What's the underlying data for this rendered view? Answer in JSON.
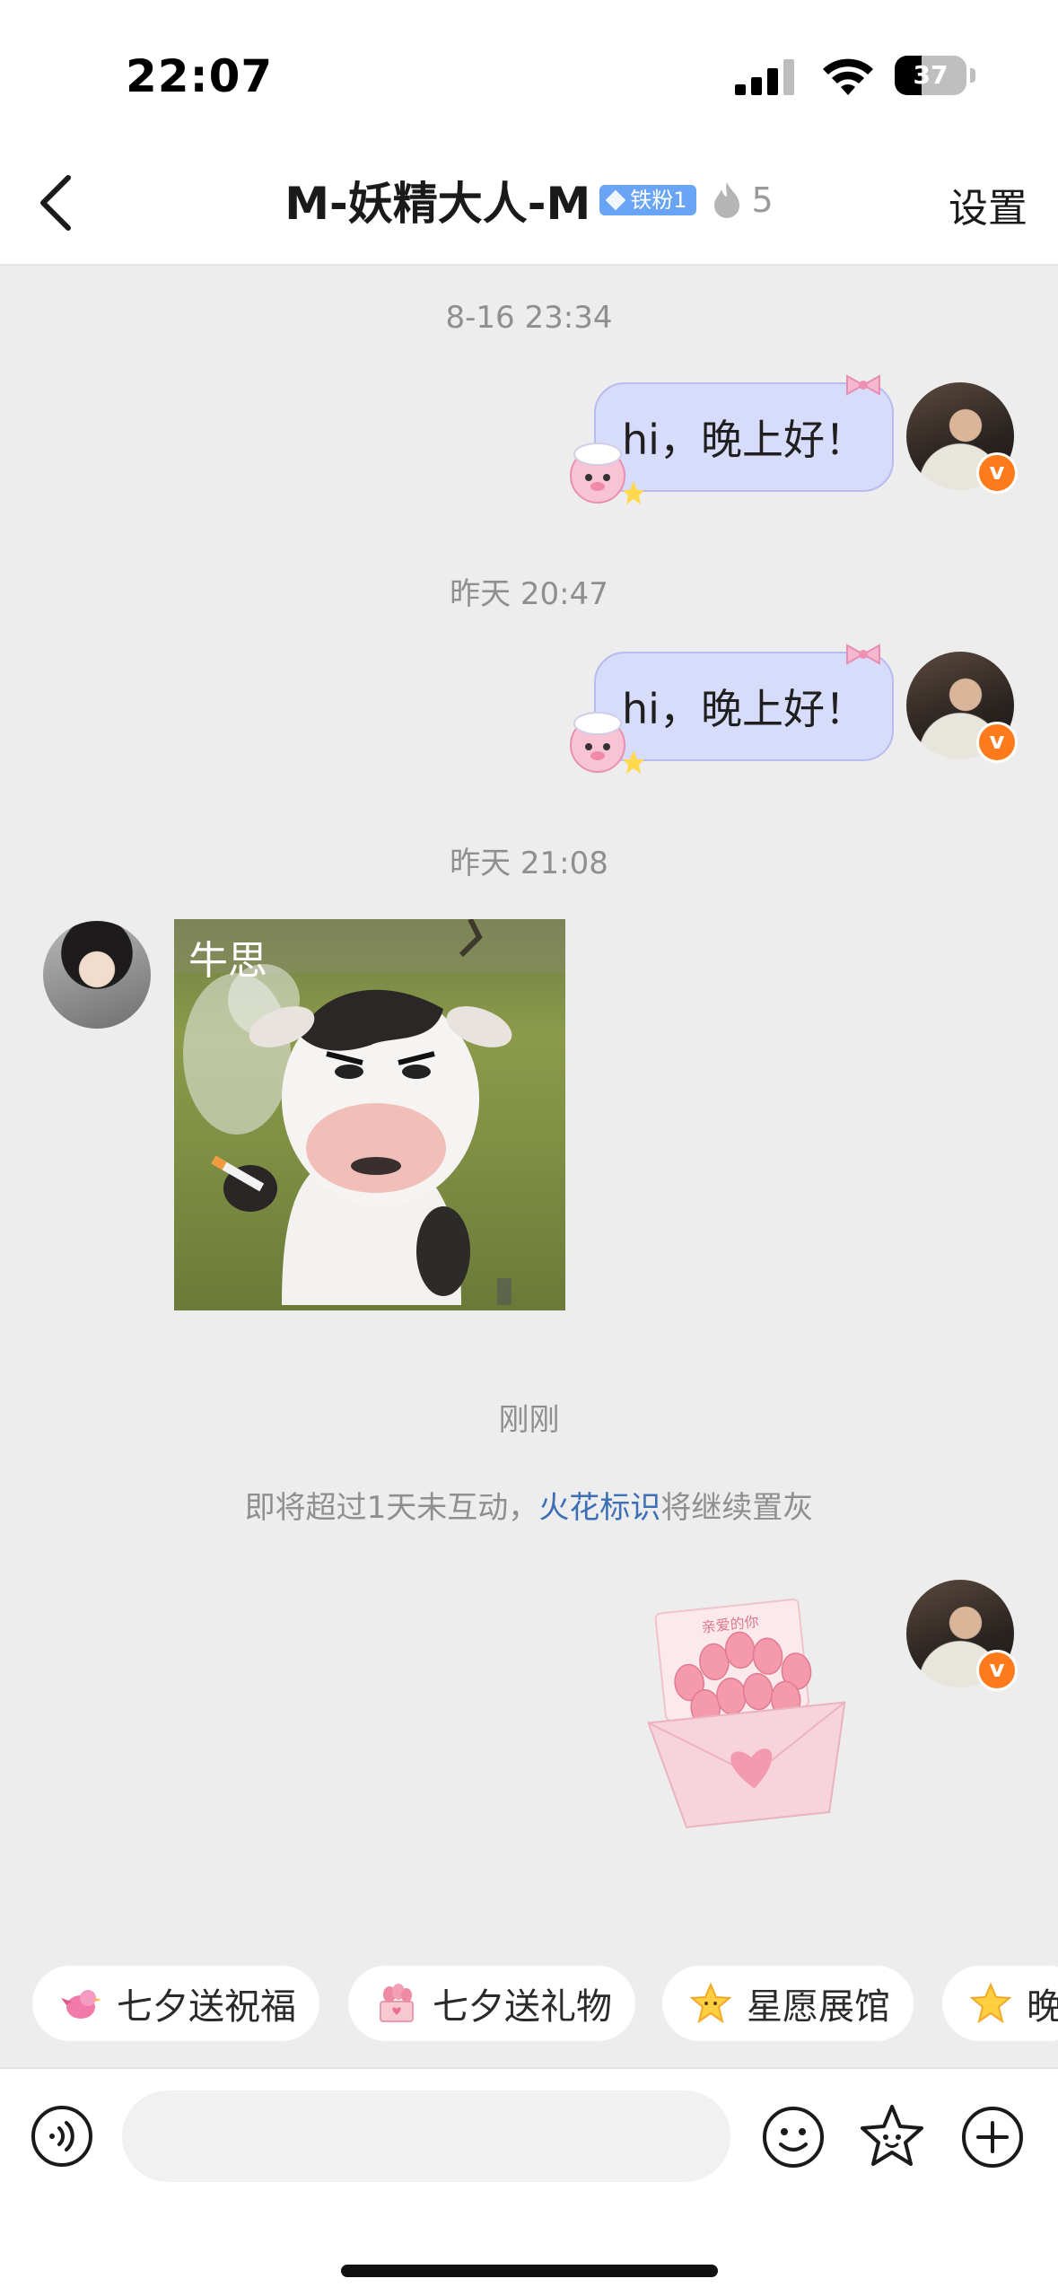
{
  "status_bar": {
    "time": "22:07",
    "battery_level": "37",
    "battery_fraction": 0.37
  },
  "nav": {
    "title": "M-妖精大人-M",
    "fan_badge": "铁粉1",
    "spark_count": "5",
    "settings_label": "设置"
  },
  "messages": [
    {
      "timestamp": "8-16 23:34",
      "text": "hi，晚上好！"
    },
    {
      "timestamp": "昨天 20:47",
      "text": "hi，晚上好！"
    },
    {
      "timestamp": "昨天 21:08",
      "image_caption": "牛思"
    }
  ],
  "notice": {
    "timestamp": "刚刚",
    "prefix": "即将超过1天未互动，",
    "link": "火花标识",
    "suffix": "将继续置灰"
  },
  "gift_card_text": "亲爱的你",
  "quick_actions": [
    {
      "label": "七夕送祝福",
      "icon": "bird-icon"
    },
    {
      "label": "七夕送礼物",
      "icon": "gift-icon"
    },
    {
      "label": "星愿展馆",
      "icon": "star-icon"
    },
    {
      "label": "晚",
      "icon": "star-icon"
    }
  ],
  "input": {
    "placeholder": "",
    "value": ""
  },
  "colors": {
    "chat_background": "#ededed",
    "bubble_fill": "#d8dcfb",
    "link": "#3c6fb6",
    "v_badge": "#ff7a1a",
    "fan_badge": "#6aa4f5"
  }
}
